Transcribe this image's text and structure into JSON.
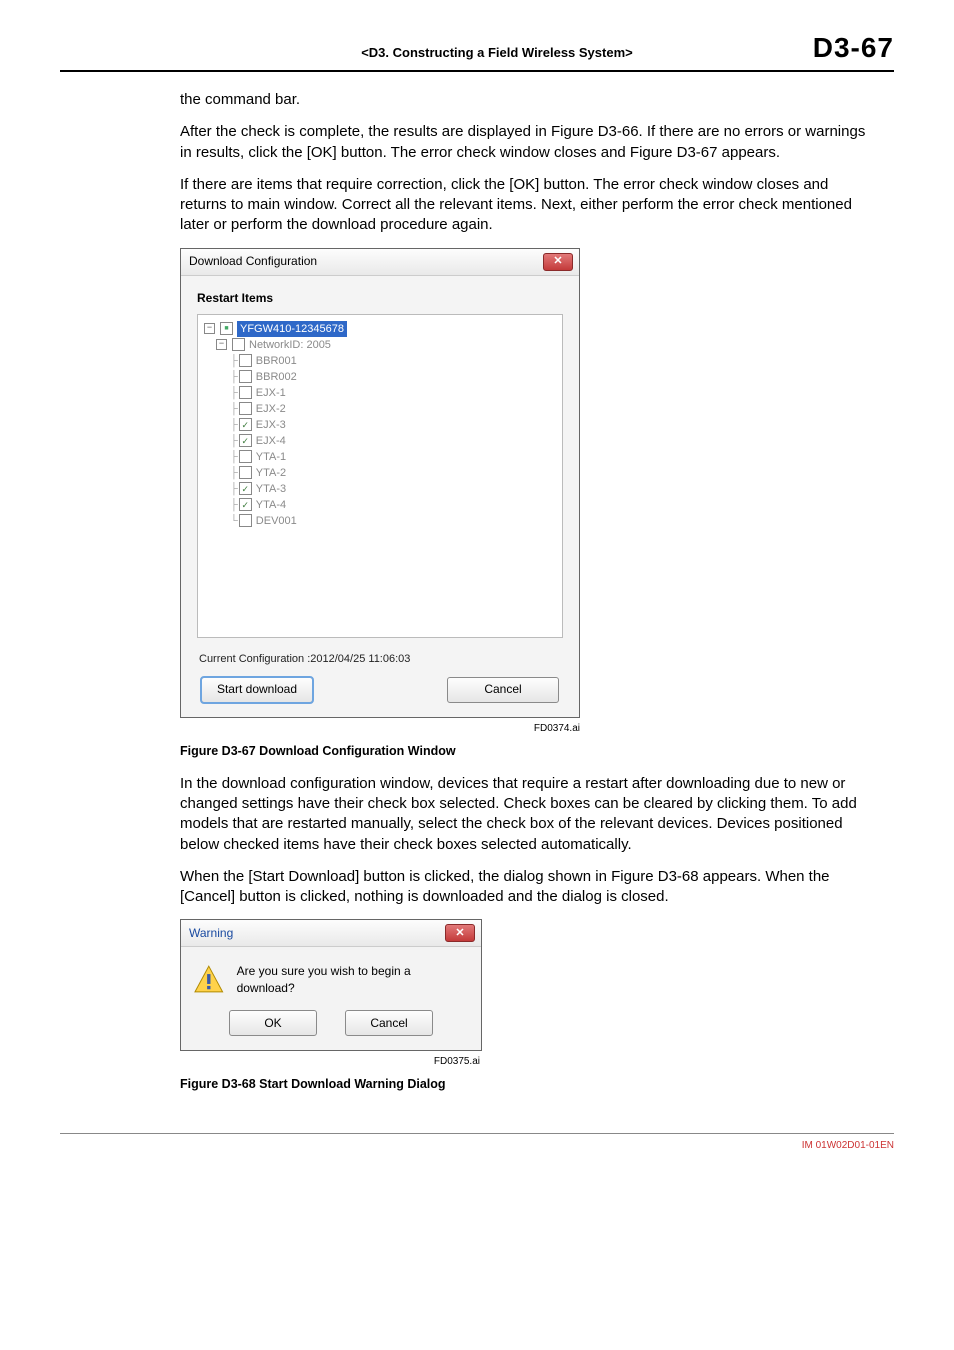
{
  "header": {
    "section": "<D3.  Constructing a Field Wireless System>",
    "page": "D3-67"
  },
  "paragraphs": {
    "p0": "the command bar.",
    "p1": "After the check is complete, the results are displayed in Figure D3-66. If there are no errors or warnings in results, click the [OK] button. The error check window closes and Figure D3-67 appears.",
    "p2": "If there are items that require correction, click the [OK] button. The error check window closes and returns to main window. Correct all the relevant items. Next, either perform the error check mentioned later or perform the download procedure again.",
    "p3": "In the download configuration window, devices that require a restart after downloading due to new or changed settings have their check box selected. Check boxes can be cleared by clicking them. To add models that are restarted manually, select the check box of the relevant devices. Devices positioned below checked items have their check boxes selected automatically.",
    "p4": "When the [Start Download] button is clicked, the dialog shown in Figure D3-68 appears. When the [Cancel] button is clicked, nothing is downloaded and the dialog is closed."
  },
  "dialog1": {
    "title": "Download Configuration",
    "restart_label": "Restart Items",
    "tree": {
      "root": "YFGW410-12345678",
      "network": "NetworkID: 2005",
      "items": [
        {
          "label": "BBR001",
          "checked": false
        },
        {
          "label": "BBR002",
          "checked": false
        },
        {
          "label": "EJX-1",
          "checked": false
        },
        {
          "label": "EJX-2",
          "checked": false
        },
        {
          "label": "EJX-3",
          "checked": true
        },
        {
          "label": "EJX-4",
          "checked": true
        },
        {
          "label": "YTA-1",
          "checked": false
        },
        {
          "label": "YTA-2",
          "checked": false
        },
        {
          "label": "YTA-3",
          "checked": true
        },
        {
          "label": "YTA-4",
          "checked": true
        },
        {
          "label": "DEV001",
          "checked": false
        }
      ]
    },
    "current_config": "Current Configuration :2012/04/25 11:06:03",
    "start_label": "Start download",
    "cancel_label": "Cancel",
    "fig_ref": "FD0374.ai"
  },
  "caption1": "Figure D3-67  Download Configuration Window",
  "dialog2": {
    "title": "Warning",
    "message": "Are you sure you wish to begin a download?",
    "ok_label": "OK",
    "cancel_label": "Cancel",
    "fig_ref": "FD0375.ai"
  },
  "caption2": "Figure D3-68  Start Download Warning Dialog",
  "footer": "IM 01W02D01-01EN"
}
